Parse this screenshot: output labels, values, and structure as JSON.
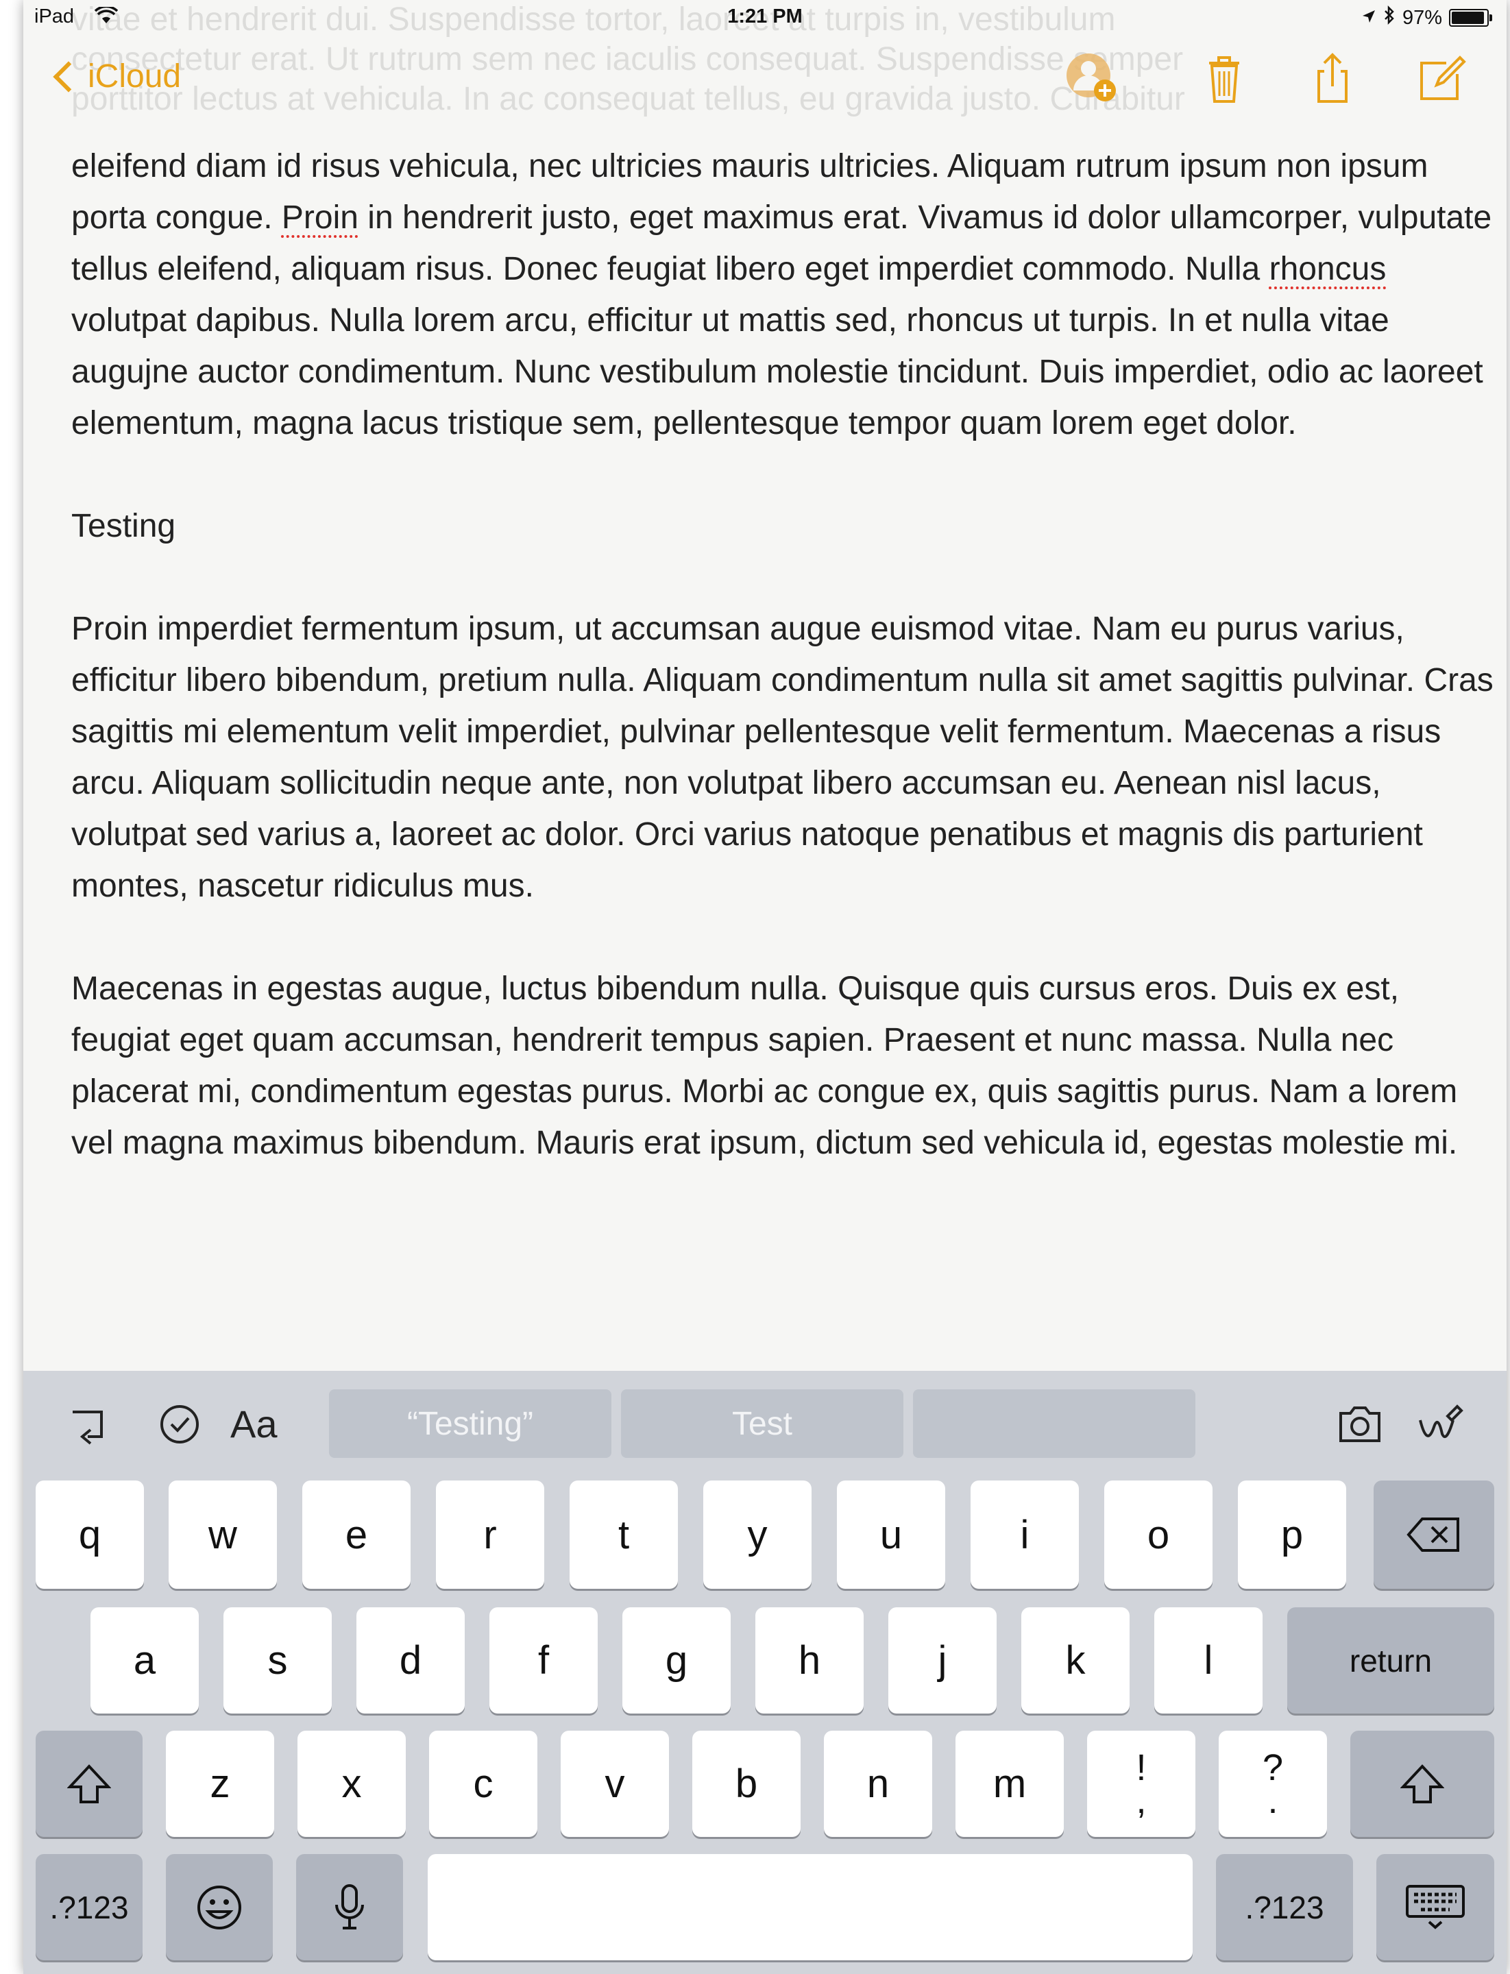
{
  "status_bar": {
    "device": "iPad",
    "time": "1:21 PM",
    "battery_percent": "97%",
    "battery_level": 0.97
  },
  "nav": {
    "back_label": "iCloud",
    "accent_color": "#e8a21a"
  },
  "faded_lines": [
    "vitae et hendrerit dui. Suspendisse tortor, laoreet at turpis in, vestibulum",
    "consectetur erat. Ut rutrum sem nec iaculis consequat. Suspendisse semper",
    "porttitor lectus at vehicula. In ac consequat tellus, eu gravida justo. Curabitur"
  ],
  "note": {
    "p1": {
      "t1": "eleifend diam id risus vehicula, nec ultricies mauris ultricies. Aliquam rutrum ipsum non ipsum porta congue. ",
      "w1": "Proin",
      "t2": " in hendrerit justo, eget maximus erat. Vivamus id dolor ullamcorper, vulputate tellus eleifend, aliquam risus. Donec feugiat libero eget imperdiet commodo. Nulla ",
      "w2": "rhoncus",
      "t3": " volutpat dapibus. Nulla lorem arcu, efficitur ut mattis sed, rhoncus ut turpis. In et nulla vitae augujne auctor condimentum. Nunc vestibulum molestie tincidunt. Duis imperdiet, odio ac laoreet elementum, magna lacus tristique sem, pellentesque tempor quam lorem eget dolor."
    },
    "heading": "Testing",
    "p2": "Proin imperdiet fermentum ipsum, ut accumsan augue euismod vitae. Nam eu purus varius, efficitur libero bibendum, pretium nulla. Aliquam condimentum nulla sit amet sagittis pulvinar. Cras sagittis mi elementum velit imperdiet, pulvinar pellentesque velit fermentum. Maecenas a risus arcu. Aliquam sollicitudin neque ante, non volutpat libero accumsan eu. Aenean nisl lacus, volutpat sed varius a, laoreet ac dolor. Orci varius natoque penatibus et magnis dis parturient montes, nascetur ridiculus mus.",
    "p3": "Maecenas in egestas augue, luctus bibendum nulla. Quisque quis cursus eros. Duis ex est, feugiat eget quam accumsan, hendrerit tempus sapien. Praesent et nunc massa. Nulla nec placerat mi, condimentum egestas purus. Morbi ac congue ex, quis sagittis purus. Nam a lorem vel magna maximus bibendum. Mauris erat ipsum, dictum sed vehicula id, egestas molestie mi."
  },
  "shortcut_bar": {
    "format_label": "Aa",
    "suggestions": [
      "“Testing”",
      "Test",
      ""
    ]
  },
  "keyboard": {
    "row1": [
      "q",
      "w",
      "e",
      "r",
      "t",
      "y",
      "u",
      "i",
      "o",
      "p"
    ],
    "row2": [
      "a",
      "s",
      "d",
      "f",
      "g",
      "h",
      "j",
      "k",
      "l"
    ],
    "row3": [
      "z",
      "x",
      "c",
      "v",
      "b",
      "n",
      "m"
    ],
    "return_label": "return",
    "sym1_top": "!",
    "sym1_bottom": ",",
    "sym2_top": "?",
    "sym2_bottom": ".",
    "numbers_label": ".?123"
  }
}
